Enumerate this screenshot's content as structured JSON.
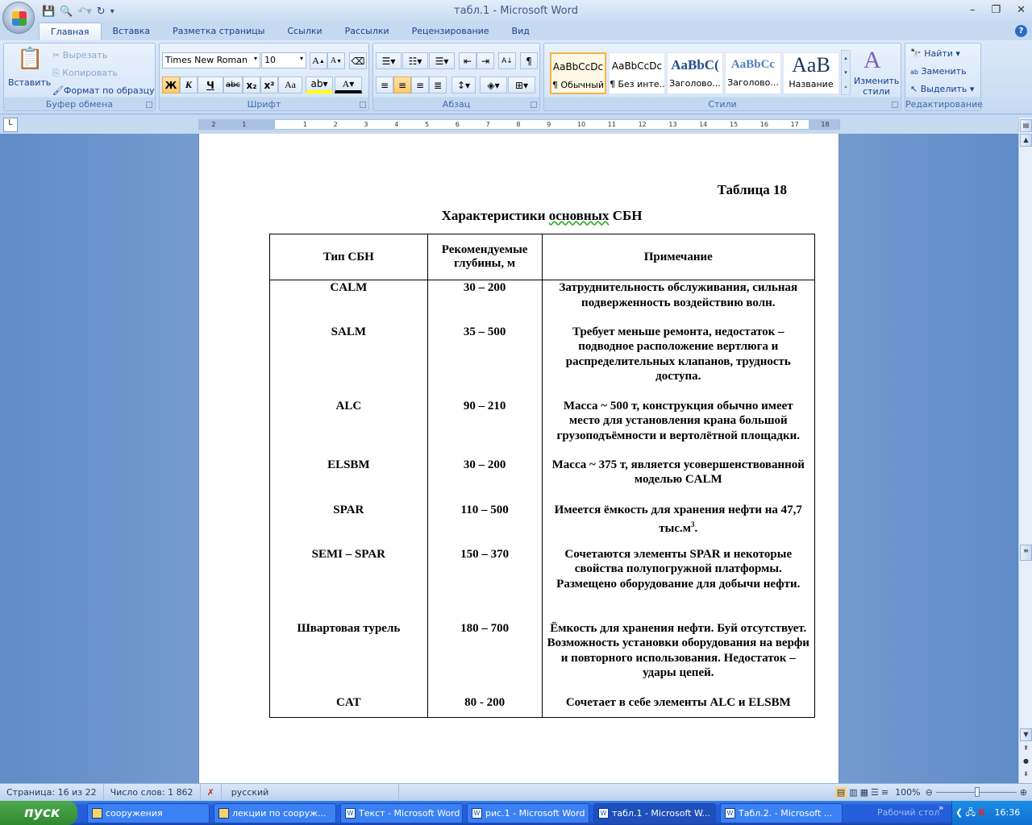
{
  "window": {
    "title": "табл.1 - Microsoft Word"
  },
  "tabs": [
    "Главная",
    "Вставка",
    "Разметка страницы",
    "Ссылки",
    "Рассылки",
    "Рецензирование",
    "Вид"
  ],
  "clipboard": {
    "paste": "Вставить",
    "cut": "Вырезать",
    "copy": "Копировать",
    "format_painter": "Формат по образцу",
    "label": "Буфер обмена"
  },
  "font": {
    "name": "Times New Roman",
    "size": "10",
    "bold": "Ж",
    "italic": "К",
    "underline": "Ч",
    "strike": "abc",
    "sub": "x₂",
    "sup": "x²",
    "case": "Aa",
    "label": "Шрифт"
  },
  "paragraph": {
    "label": "Абзац"
  },
  "styles": {
    "items": [
      {
        "preview": "AaBbCcDc",
        "name": "¶ Обычный"
      },
      {
        "preview": "AaBbCcDc",
        "name": "¶ Без инте..."
      },
      {
        "preview": "AaBbC(",
        "name": "Заголово..."
      },
      {
        "preview": "AaBbCc",
        "name": "Заголово..."
      },
      {
        "preview": "AaB",
        "name": "Название"
      }
    ],
    "change": "Изменить стили",
    "label": "Стили"
  },
  "editing": {
    "find": "Найти",
    "replace": "Заменить",
    "select": "Выделить",
    "label": "Редактирование"
  },
  "ruler": [
    "2",
    "1",
    "1",
    "2",
    "3",
    "4",
    "5",
    "6",
    "7",
    "8",
    "9",
    "10",
    "11",
    "12",
    "13",
    "14",
    "15",
    "16",
    "17",
    "18"
  ],
  "document": {
    "table_number": "Таблица 18",
    "title_pre": "Характеристики ",
    "title_wavy": "основных",
    "title_post": " СБН",
    "headers": [
      "Тип СБН",
      "Рекомендуемые глубины, м",
      "Примечание"
    ],
    "rows": [
      {
        "type": "CALM",
        "depth": "30 – 200",
        "note": "Затруднительность обслуживания, сильная подверженность воздействию волн."
      },
      {
        "type": "SALM",
        "depth": "35 – 500",
        "note": "Требует меньше ремонта, недостаток – подводное расположение вертлюга и распределительных клапанов, трудность доступа."
      },
      {
        "type": "ALC",
        "depth": "90 – 210",
        "note": "Масса ~ 500 т, конструкция обычно имеет место для установления крана большой грузоподъёмности и вертолётной площадки."
      },
      {
        "type": "ELSBM",
        "depth": "30 – 200",
        "note": "Масса ~ 375 т, является усовершенствованной моделью CALM"
      },
      {
        "type": "SPAR",
        "depth": "110 – 500",
        "note": "Имеется ёмкость для хранения нефти на 47,7 тыс.м",
        "note_sup": "3",
        "note_end": "."
      },
      {
        "type": "SEMI – SPAR",
        "depth": "150 – 370",
        "note": "Сочетаются элементы SPAR и некоторые свойства полупогружной платформы. Размещено оборудование для добычи нефти."
      },
      {
        "type": "Швартовая турель",
        "depth": "180 – 700",
        "note": "Ёмкость для хранения нефти. Буй отсутствует. Возможность установки оборудования на верфи и повторного использования. Недостаток – удары цепей."
      },
      {
        "type": "CAT",
        "depth": "80 - 200",
        "note": "Сочетает в себе элементы ALC и ELSBM"
      }
    ]
  },
  "status": {
    "page": "Страница: 16 из 22",
    "words": "Число слов: 1 862",
    "lang": "русский",
    "zoom": "100%"
  },
  "taskbar": {
    "start": "пуск",
    "items": [
      "сооружения",
      "лекции по сооруж...",
      "Текст - Microsoft Word",
      "рис.1 - Microsoft Word",
      "табл.1 - Microsoft W...",
      "Табл.2. - Microsoft ..."
    ],
    "desktop": "Рабочий стол",
    "clock": "16:36"
  }
}
